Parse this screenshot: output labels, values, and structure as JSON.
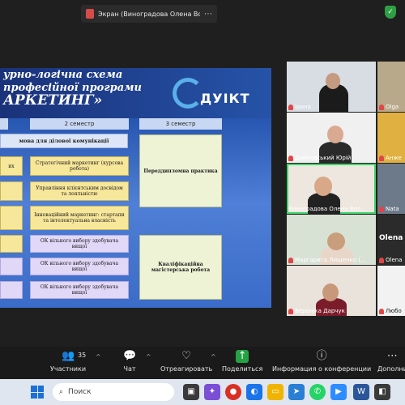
{
  "share_bar": {
    "title": "Экран (Виноградова Олена Вол",
    "more": "⋯"
  },
  "slide": {
    "title_line1": "урно-логічна схема",
    "title_line2": "професійної програми",
    "title_line3": "АРКЕТИНГ»",
    "logo_text": "ДУІКТ",
    "semester2": "2 семестр",
    "semester3": "3 семестр",
    "lang_box": "мова для ділової комунікації",
    "col1": [
      "их",
      "",
      "",
      ""
    ],
    "col2": [
      "Стратегічний маркетинг (курсова робота)",
      "Управління клієнтським досвідом та лояльністю",
      "Інноваційний маркетинг: стартапи та інтелектуальна власність",
      "ОК вільного вибору здобувача вищої",
      "ОК вільного вибору здобувача вищої",
      "ОК вільного вибору здобувача вищої"
    ],
    "col3": [
      "Переддипломна практика",
      "Кваліфікаційна магістерська робота"
    ]
  },
  "participants": [
    {
      "name": "Ірина"
    },
    {
      "name": "Olga"
    },
    {
      "name": "Дайновський Юрій"
    },
    {
      "name": "Анже"
    },
    {
      "name": "Виноградова Олена Вол..."
    },
    {
      "name": "Nata"
    },
    {
      "name": "Маргарита Лищенко (..."
    },
    {
      "name": "Olena"
    },
    {
      "name": "Вероніка Дарчук"
    },
    {
      "name": "Любо"
    }
  ],
  "side_name": "Olena",
  "toolbar": {
    "participants_count": "35",
    "participants": "Участники",
    "chat": "Чат",
    "react": "Отреагировать",
    "share": "Поделиться",
    "info": "Информация о конференции",
    "more": "Дополни"
  },
  "taskbar": {
    "search_placeholder": "Поиск"
  },
  "colors": {
    "accent_green": "#25a244",
    "mic_muted": "#e04646"
  }
}
